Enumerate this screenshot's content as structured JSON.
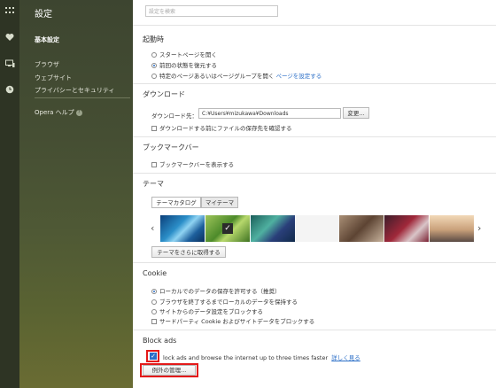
{
  "rail": {
    "icons": [
      "grid-icon",
      "heart-icon",
      "devices-icon",
      "clock-icon"
    ]
  },
  "sidebar": {
    "title": "設定",
    "items": [
      {
        "label": "基本設定",
        "active": true
      },
      {
        "label": "ブラウザ"
      },
      {
        "label": "ウェブサイト"
      },
      {
        "label": "プライバシーとセキュリティ"
      }
    ],
    "help": "Opera ヘルプ",
    "help_icon": "?"
  },
  "search": {
    "placeholder": "設定を検索"
  },
  "startup": {
    "heading": "起動時",
    "options": [
      "スタートページを開く",
      "前回の状態を復元する",
      "特定のページあるいはページグループを開く"
    ],
    "selected": 1,
    "set_pages_link": "ページを設定する"
  },
  "download": {
    "heading": "ダウンロード",
    "label": "ダウンロード先：",
    "path": "C:¥Users¥mizukawa¥Downloads",
    "change_button": "変更...",
    "ask_checkbox": "ダウンロードする前にファイルの保存先を確認する"
  },
  "bookmarks": {
    "heading": "ブックマークバー",
    "show_checkbox": "ブックマークバーを表示する"
  },
  "themes": {
    "heading": "テーマ",
    "tabs": [
      "テーマカタログ",
      "マイテーマ"
    ],
    "prev_arrow": "‹",
    "next_arrow": "›",
    "check_mark": "✓",
    "more_button": "テーマをさらに取得する"
  },
  "cookie": {
    "heading": "Cookie",
    "options": [
      "ローカルでのデータの保存を許可する（推奨）",
      "ブラウザを終了するまでローカルのデータを保持する",
      "サイトからのデータ設定をブロックする"
    ],
    "selected": 0,
    "third_party_checkbox": "サードパーティ Cookie およびサイトデータをブロックする"
  },
  "blockads": {
    "heading": "Block ads",
    "checkbox_label": "lock ads and browse the internet up to three times faster",
    "learn_more": "詳しく見る",
    "checked": true,
    "exceptions_button": "例外の管理..."
  },
  "colors": {
    "highlight": "#e31919",
    "link": "#2a6ec7",
    "checkbox_blue": "#2a6ec7"
  }
}
